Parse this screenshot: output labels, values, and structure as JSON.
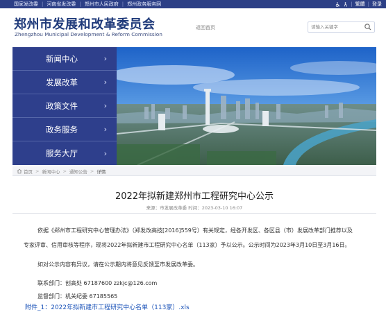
{
  "topbar": {
    "links": [
      "国家发改委",
      "河南省发改委",
      "郑州市人民政府",
      "郑州政务服务网"
    ],
    "tools": {
      "accessibility_icon": "wheelchair-icon",
      "elder_icon": "elder-icon",
      "traditional": "繁體",
      "login": "登录"
    }
  },
  "header": {
    "title": "郑州市发展和改革委员会",
    "subtitle": "Zhengzhou Municipal Development & Reform Commission",
    "home_link": "返回首页",
    "search_placeholder": "请输入关键字"
  },
  "nav": {
    "items": [
      {
        "label": "新闻中心"
      },
      {
        "label": "发展改革"
      },
      {
        "label": "政策文件"
      },
      {
        "label": "政务服务"
      },
      {
        "label": "服务大厅"
      }
    ]
  },
  "breadcrumb": {
    "items": [
      "首页",
      "新闻中心",
      "通知公告"
    ],
    "current": "详情"
  },
  "article": {
    "title": "2022年拟新建郑州市工程研究中心公示",
    "meta": "来源：市发展改革委   时间：2023-03-10 16:07",
    "p1": "依据《郑州市工程研究中心管理办法》（郑发改高技[2016]559号）有关规定，经各开发区、各区县（市）发展改革部门推荐以及",
    "p2": "专家评审、信用审核等程序，现将2022年拟新建市工程研究中心名单（113家）予以公示。公示时间为2023年3月10日至3月16日。",
    "p3": "如对公示内容有异议，请在公示期内将意见反馈至市发展改革委。",
    "p4": "联系部门：创高处    67187600  zzkjc@126.com",
    "p5": "监督部门：机关纪委 67185565",
    "attachment": "附件_1：2022年拟新建市工程研究中心名单（113家）.xls"
  },
  "colors": {
    "brand_navy": "#2e3f8c",
    "title_blue": "#1f3a7a",
    "link_blue": "#1a52b8"
  }
}
